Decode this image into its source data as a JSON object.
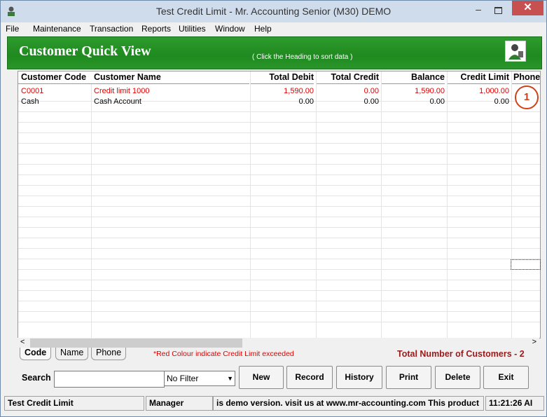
{
  "window": {
    "title": "Test Credit Limit - Mr. Accounting Senior (M30) DEMO",
    "min_symbol": "–",
    "close_symbol": "✕"
  },
  "menu": [
    "File",
    "Maintenance",
    "Transaction",
    "Reports",
    "Utilities",
    "Window",
    "Help"
  ],
  "banner": {
    "title": "Customer Quick View",
    "hint": "( Click the Heading to sort data )"
  },
  "table": {
    "headers": {
      "code": "Customer Code",
      "name": "Customer Name",
      "debit": "Total Debit",
      "credit": "Total Credit",
      "balance": "Balance",
      "limit": "Credit Limit",
      "phone": "Phone"
    },
    "rows": [
      {
        "code": "C0001",
        "name": "Credit limit 1000",
        "debit": "1,590.00",
        "credit": "0.00",
        "balance": "1,590.00",
        "limit": "1,000.00",
        "over_limit": true
      },
      {
        "code": "Cash",
        "name": "Cash Account",
        "debit": "0.00",
        "credit": "0.00",
        "balance": "0.00",
        "limit": "0.00",
        "over_limit": false
      }
    ]
  },
  "annotation_badge": "1",
  "tabs": [
    "Code",
    "Name",
    "Phone"
  ],
  "legend": "*Red Colour indicate Credit Limit exceeded",
  "total_customers": "Total Number of Customers - 2",
  "search": {
    "label": "Search",
    "value": ""
  },
  "filter": {
    "value": "No Filter"
  },
  "buttons": {
    "new": "New",
    "record": "Record",
    "history": "History",
    "print": "Print",
    "delete": "Delete",
    "exit": "Exit"
  },
  "status": {
    "company": "Test Credit Limit",
    "user": "Manager",
    "message": "is demo version.  visit us at www.mr-accounting.com This product",
    "time": "11:21:26 AI"
  },
  "colors": {
    "banner_green": "#1f8a1f",
    "over_limit_red": "#e00000",
    "total_text": "#9a1a1a"
  }
}
